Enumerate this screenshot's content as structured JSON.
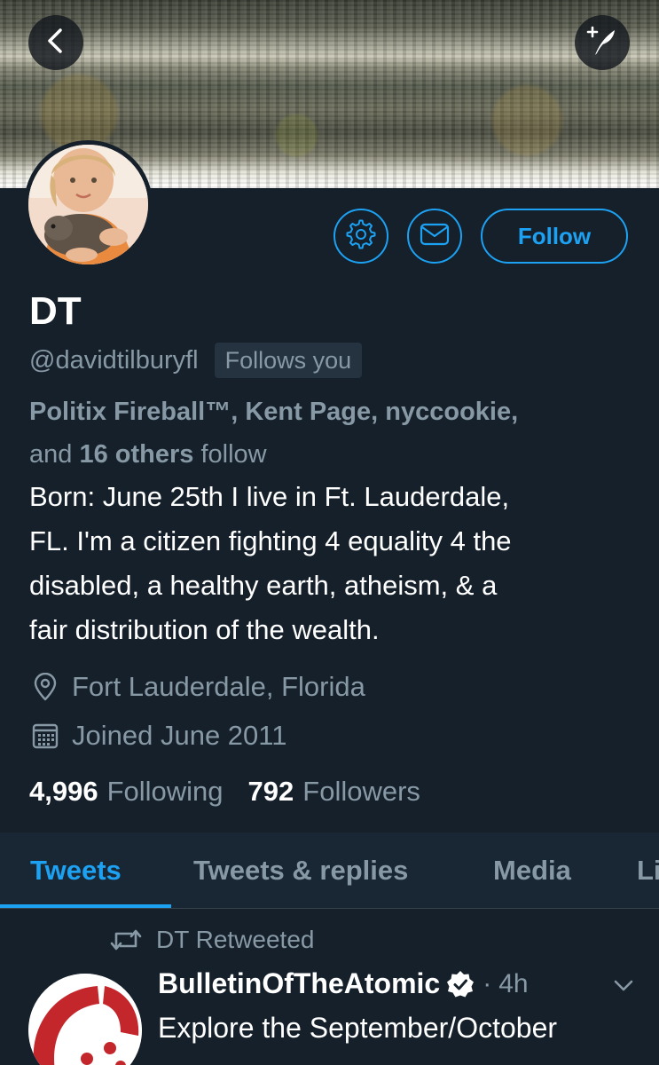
{
  "colors": {
    "background": "#15202b",
    "accent": "#1da1f2",
    "secondary_text": "#8899a6",
    "tab_bar": "#192734",
    "badge_bg": "#253341"
  },
  "header": {
    "back_icon": "chevron-left-icon",
    "compose_icon": "compose-quill-icon"
  },
  "profile": {
    "name": "DT",
    "handle": "@davidtilburyfl",
    "follows_you_badge": "Follows you",
    "followed_by": {
      "names_line": "Politix Fireball™, Kent Page, nyccookie,",
      "and": "and",
      "others_count": "16 others",
      "follow": "follow"
    },
    "bio": "Born: June 25th I live in Ft. Lauderdale,\nFL. I'm a citizen fighting 4 equality 4 the\ndisabled, a healthy earth, atheism, & a\nfair distribution of the wealth.",
    "location": "Fort Lauderdale, Florida",
    "joined": "Joined June 2011",
    "following_count": "4,996",
    "following_label": "Following",
    "followers_count": "792",
    "followers_label": "Followers"
  },
  "actions": {
    "settings_icon": "gear-icon",
    "message_icon": "envelope-icon",
    "follow_label": "Follow"
  },
  "tabs": [
    {
      "label": "Tweets",
      "active": true
    },
    {
      "label": "Tweets & replies",
      "active": false
    },
    {
      "label": "Media",
      "active": false
    },
    {
      "label": "Li",
      "active": false
    }
  ],
  "tweet": {
    "retweet_label": "DT Retweeted",
    "author": "BulletinOfTheAtomic",
    "time_separator": "·",
    "time": "4h",
    "text": "Explore the September/October"
  }
}
